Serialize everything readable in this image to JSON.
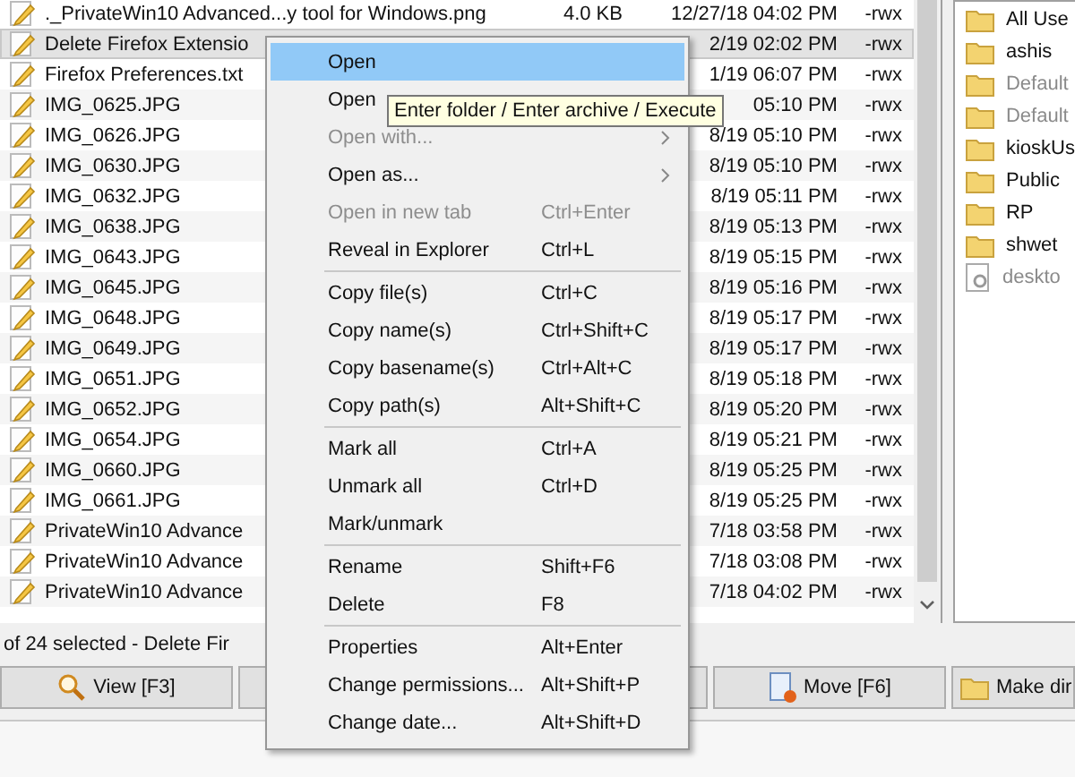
{
  "files": [
    {
      "name": "._PrivateWin10 Advanced...y tool for Windows.png",
      "size": "4.0 KB",
      "date": "12/27/18 04:02 PM",
      "attr": "-rwx",
      "selected": false
    },
    {
      "name": "Delete Firefox Extensio",
      "date": "2/19 02:02 PM",
      "attr": "-rwx",
      "selected": true
    },
    {
      "name": "Firefox Preferences.txt",
      "date": "1/19 06:07 PM",
      "attr": "-rwx",
      "selected": false
    },
    {
      "name": "IMG_0625.JPG",
      "date": "05:10 PM",
      "attr": "-rwx",
      "selected": false
    },
    {
      "name": "IMG_0626.JPG",
      "date": "8/19 05:10 PM",
      "attr": "-rwx",
      "selected": false
    },
    {
      "name": "IMG_0630.JPG",
      "date": "8/19 05:10 PM",
      "attr": "-rwx",
      "selected": false
    },
    {
      "name": "IMG_0632.JPG",
      "date": "8/19 05:11 PM",
      "attr": "-rwx",
      "selected": false
    },
    {
      "name": "IMG_0638.JPG",
      "date": "8/19 05:13 PM",
      "attr": "-rwx",
      "selected": false
    },
    {
      "name": "IMG_0643.JPG",
      "date": "8/19 05:15 PM",
      "attr": "-rwx",
      "selected": false
    },
    {
      "name": "IMG_0645.JPG",
      "date": "8/19 05:16 PM",
      "attr": "-rwx",
      "selected": false
    },
    {
      "name": "IMG_0648.JPG",
      "date": "8/19 05:17 PM",
      "attr": "-rwx",
      "selected": false
    },
    {
      "name": "IMG_0649.JPG",
      "date": "8/19 05:17 PM",
      "attr": "-rwx",
      "selected": false
    },
    {
      "name": "IMG_0651.JPG",
      "date": "8/19 05:18 PM",
      "attr": "-rwx",
      "selected": false
    },
    {
      "name": "IMG_0652.JPG",
      "date": "8/19 05:20 PM",
      "attr": "-rwx",
      "selected": false
    },
    {
      "name": "IMG_0654.JPG",
      "date": "8/19 05:21 PM",
      "attr": "-rwx",
      "selected": false
    },
    {
      "name": "IMG_0660.JPG",
      "date": "8/19 05:25 PM",
      "attr": "-rwx",
      "selected": false
    },
    {
      "name": "IMG_0661.JPG",
      "date": "8/19 05:25 PM",
      "attr": "-rwx",
      "selected": false
    },
    {
      "name": "PrivateWin10 Advance",
      "date": "7/18 03:58 PM",
      "attr": "-rwx",
      "selected": false
    },
    {
      "name": "PrivateWin10 Advance",
      "date": "7/18 03:08 PM",
      "attr": "-rwx",
      "selected": false
    },
    {
      "name": "PrivateWin10 Advance",
      "date": "7/18 04:02 PM",
      "attr": "-rwx",
      "selected": false
    }
  ],
  "side_items": [
    {
      "kind": "folder",
      "name": "All Use",
      "dimmed": false
    },
    {
      "kind": "folder",
      "name": "ashis",
      "dimmed": false
    },
    {
      "kind": "folder",
      "name": "Default",
      "dimmed": true
    },
    {
      "kind": "folder",
      "name": "Default",
      "dimmed": true
    },
    {
      "kind": "folder",
      "name": "kioskUs",
      "dimmed": false
    },
    {
      "kind": "folder",
      "name": "Public",
      "dimmed": false
    },
    {
      "kind": "folder",
      "name": "RP",
      "dimmed": false
    },
    {
      "kind": "folder",
      "name": "shwet",
      "dimmed": false
    },
    {
      "kind": "file",
      "name": "deskto",
      "dimmed": true
    }
  ],
  "status": "of 24 selected - Delete Fir",
  "buttons": [
    {
      "kind": "view",
      "label": "View [F3]"
    },
    {
      "kind": "blank"
    },
    {
      "kind": "move",
      "label": "Move [F6]"
    },
    {
      "kind": "mkdir",
      "label": "Make dir"
    }
  ],
  "menu": [
    {
      "kind": "item",
      "label": "Open",
      "selected": true,
      "disabled": false,
      "submenu": false
    },
    {
      "kind": "item",
      "label": "Open",
      "selected": false,
      "disabled": false,
      "submenu": false
    },
    {
      "kind": "item",
      "label": "Open with...",
      "selected": false,
      "disabled": true,
      "submenu": true
    },
    {
      "kind": "item",
      "label": "Open as...",
      "selected": false,
      "disabled": false,
      "submenu": true
    },
    {
      "kind": "item",
      "label": "Open in new tab",
      "shortcut": "Ctrl+Enter",
      "selected": false,
      "disabled": true,
      "submenu": false
    },
    {
      "kind": "item",
      "label": "Reveal in Explorer",
      "shortcut": "Ctrl+L",
      "selected": false,
      "disabled": false,
      "submenu": false
    },
    {
      "kind": "separator"
    },
    {
      "kind": "item",
      "label": "Copy file(s)",
      "shortcut": "Ctrl+C",
      "selected": false,
      "disabled": false,
      "submenu": false
    },
    {
      "kind": "item",
      "label": "Copy name(s)",
      "shortcut": "Ctrl+Shift+C",
      "selected": false,
      "disabled": false,
      "submenu": false
    },
    {
      "kind": "item",
      "label": "Copy basename(s)",
      "shortcut": "Ctrl+Alt+C",
      "selected": false,
      "disabled": false,
      "submenu": false
    },
    {
      "kind": "item",
      "label": "Copy path(s)",
      "shortcut": "Alt+Shift+C",
      "selected": false,
      "disabled": false,
      "submenu": false
    },
    {
      "kind": "separator"
    },
    {
      "kind": "item",
      "label": "Mark all",
      "shortcut": "Ctrl+A",
      "selected": false,
      "disabled": false,
      "submenu": false
    },
    {
      "kind": "item",
      "label": "Unmark all",
      "shortcut": "Ctrl+D",
      "selected": false,
      "disabled": false,
      "submenu": false
    },
    {
      "kind": "item",
      "label": "Mark/unmark",
      "selected": false,
      "disabled": false,
      "submenu": false
    },
    {
      "kind": "separator"
    },
    {
      "kind": "item",
      "label": "Rename",
      "shortcut": "Shift+F6",
      "selected": false,
      "disabled": false,
      "submenu": false
    },
    {
      "kind": "item",
      "label": "Delete",
      "shortcut": "F8",
      "selected": false,
      "disabled": false,
      "submenu": false
    },
    {
      "kind": "separator"
    },
    {
      "kind": "item",
      "label": "Properties",
      "shortcut": "Alt+Enter",
      "selected": false,
      "disabled": false,
      "submenu": false
    },
    {
      "kind": "item",
      "label": "Change permissions...",
      "shortcut": "Alt+Shift+P",
      "selected": false,
      "disabled": false,
      "submenu": false
    },
    {
      "kind": "item",
      "label": "Change date...",
      "shortcut": "Alt+Shift+D",
      "selected": false,
      "disabled": false,
      "submenu": false
    }
  ],
  "tooltip": "Enter folder / Enter archive / Execute"
}
